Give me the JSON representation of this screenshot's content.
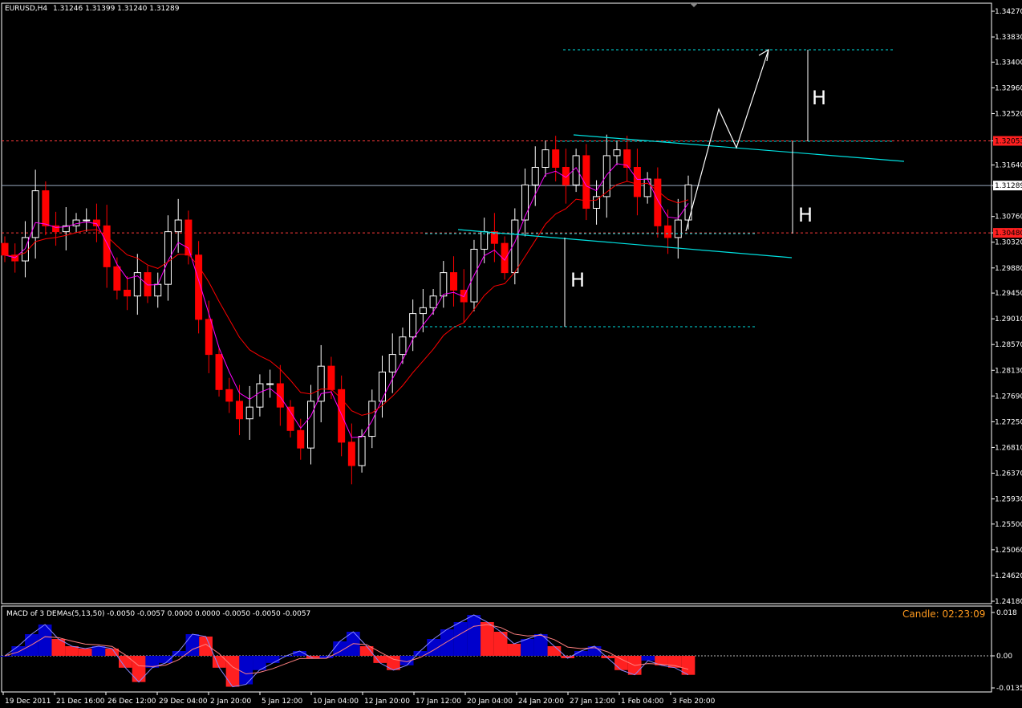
{
  "header": {
    "symbol": "EURUSD,H4",
    "ohlc": "1.31246 1.31399 1.31240 1.31289"
  },
  "macd_panel": {
    "label": "MACD of 3 DEMAs(5,13,50) -0.0050 -0.0057 0.0000 0.0000 -0.0050 -0.0050 -0.0057",
    "candle_timer": "Candle:  02:23:09",
    "ticks": [
      "0.018",
      "0.00",
      "-0.0135"
    ]
  },
  "annotations": {
    "h_labels": [
      "H",
      "H",
      "H"
    ]
  },
  "price_axis": {
    "ticks": [
      "1.34270",
      "1.33830",
      "1.33400",
      "1.32960",
      "1.32520",
      "1.32053",
      "1.31640",
      "1.31289",
      "1.30760",
      "1.30480",
      "1.30320",
      "1.29880",
      "1.29450",
      "1.29010",
      "1.28570",
      "1.28130",
      "1.27690",
      "1.27250",
      "1.26810",
      "1.26370",
      "1.25930",
      "1.25500",
      "1.25060",
      "1.24620",
      "1.24180"
    ],
    "tick_values": [
      1.3427,
      1.3383,
      1.334,
      1.3296,
      1.3252,
      1.32053,
      1.3164,
      1.31289,
      1.3076,
      1.3048,
      1.3032,
      1.2988,
      1.2945,
      1.2901,
      1.2857,
      1.2813,
      1.2769,
      1.2725,
      1.2681,
      1.2637,
      1.2593,
      1.255,
      1.2506,
      1.2462,
      1.2418
    ],
    "highlighted": [
      "1.32053",
      "1.31289",
      "1.30480"
    ]
  },
  "time_axis": {
    "labels": [
      "19 Dec 2011",
      "21 Dec 16:00",
      "26 Dec 12:00",
      "29 Dec 04:00",
      "2 Jan 20:00",
      "5 Jan 12:00",
      "10 Jan 04:00",
      "12 Jan 20:00",
      "17 Jan 12:00",
      "20 Jan 04:00",
      "24 Jan 20:00",
      "27 Jan 12:00",
      "1 Feb 04:00",
      "3 Feb 20:00"
    ]
  },
  "colors": {
    "background": "#000000",
    "bull_candle": "#ffffff",
    "bear_candle": "#ff0000",
    "ma_fast": "#ff00ff",
    "ma_slow": "#ff0000",
    "channel": "#00e0e0",
    "level_red": "#ff3b3b",
    "macd_blue": "#0000cc",
    "macd_red": "#ff2020",
    "timer": "#ff9a1e",
    "axis": "#ffffff"
  },
  "chart_data": {
    "type": "candlestick",
    "symbol": "EURUSD",
    "timeframe": "H4",
    "x": [
      "19 Dec 2011",
      "21 Dec 16:00",
      "26 Dec 12:00",
      "29 Dec 04:00",
      "2 Jan 20:00",
      "5 Jan 12:00",
      "10 Jan 04:00",
      "12 Jan 20:00",
      "17 Jan 12:00",
      "20 Jan 04:00",
      "24 Jan 20:00",
      "27 Jan 12:00",
      "1 Feb 04:00",
      "3 Feb 20:00"
    ],
    "close_path": [
      1.301,
      1.3,
      1.304,
      1.312,
      1.306,
      1.305,
      1.306,
      1.307,
      1.307,
      1.306,
      1.299,
      1.295,
      1.294,
      1.298,
      1.294,
      1.296,
      1.305,
      1.307,
      1.301,
      1.29,
      1.284,
      1.278,
      1.276,
      1.273,
      1.275,
      1.279,
      1.279,
      1.275,
      1.271,
      1.268,
      1.276,
      1.282,
      1.278,
      1.269,
      1.265,
      1.27,
      1.276,
      1.281,
      1.284,
      1.287,
      1.291,
      1.292,
      1.294,
      1.298,
      1.295,
      1.293,
      1.302,
      1.305,
      1.303,
      1.298,
      1.307,
      1.313,
      1.316,
      1.319,
      1.316,
      1.313,
      1.318,
      1.309,
      1.311,
      1.318,
      1.319,
      1.316,
      1.311,
      1.314,
      1.306,
      1.304,
      1.307,
      1.313
    ],
    "ylim": [
      1.2418,
      1.3427
    ],
    "levels": {
      "resistance": 1.32053,
      "current": 1.31289,
      "support": 1.3048
    },
    "macd": {
      "range": [
        -0.0135,
        0.018
      ],
      "hist": [
        0.0,
        0.004,
        0.009,
        0.013,
        0.007,
        0.004,
        0.003,
        0.004,
        0.003,
        -0.005,
        -0.011,
        -0.005,
        -0.003,
        0.002,
        0.009,
        0.008,
        -0.005,
        -0.013,
        -0.012,
        -0.006,
        -0.003,
        0.0,
        0.002,
        -0.001,
        -0.001,
        0.006,
        0.01,
        0.004,
        -0.003,
        -0.006,
        -0.004,
        0.002,
        0.007,
        0.011,
        0.014,
        0.017,
        0.014,
        0.01,
        0.005,
        0.007,
        0.009,
        0.004,
        -0.001,
        0.002,
        0.004,
        -0.001,
        -0.006,
        -0.008,
        -0.002,
        -0.004,
        -0.005,
        -0.008
      ]
    }
  }
}
